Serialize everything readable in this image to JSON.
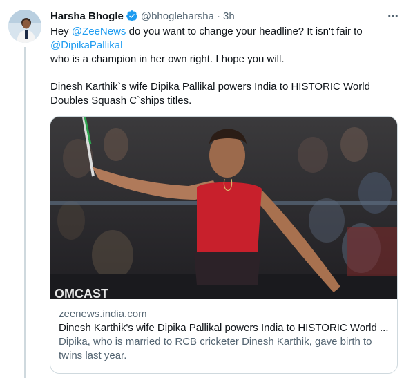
{
  "author": {
    "name": "Harsha Bhogle",
    "handle": "@bhogleharsha",
    "separator": "·",
    "time": "3h"
  },
  "tweet": {
    "line1_prefix": "Hey ",
    "mention_zee": "@ZeeNews",
    "line1_suffix": " do you want to change your headline? It isn't fair to",
    "mention_dipika": "@DipikaPallikal",
    "line3": "who is a champion in her own right. I hope you will.",
    "quote_line1": "Dinesh Karthik`s wife Dipika Pallikal powers India to HISTORIC World",
    "quote_line2": "Doubles Squash C`ships titles."
  },
  "card": {
    "domain": "zeenews.india.com",
    "title": "Dinesh Karthik's wife Dipika Pallikal powers India to HISTORIC World ...",
    "description": "Dipika, who is married to RCB cricketer Dinesh Karthik, gave birth to twins last year.",
    "image_watermark": "OMCAST"
  },
  "colors": {
    "link": "#1d9bf0",
    "text": "#0f1419",
    "secondary": "#536471",
    "border": "#cfd9de",
    "verified": "#1d9bf0"
  },
  "icons": {
    "verified": "verified-badge-icon",
    "more": "more-horizontal-icon"
  }
}
